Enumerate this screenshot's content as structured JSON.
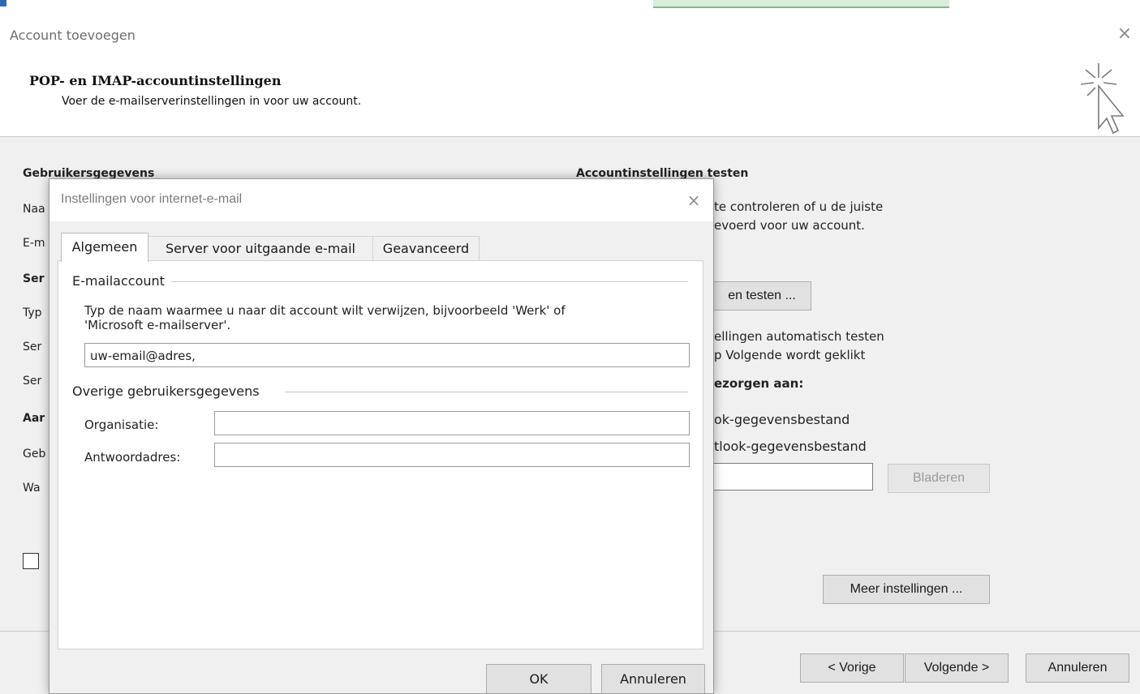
{
  "outer": {
    "title": "Account toevoegen",
    "close_icon": "×",
    "section_title": "POP- en IMAP-accountinstellingen",
    "section_subtitle": "Voer de e-mailserverinstellingen in voor uw account.",
    "left_labels": {
      "gebruikersgegevens": "Gebruikersgegevens",
      "naam": "Naa",
      "email": "E-m",
      "server": "Ser",
      "type": "Typ",
      "server2": "Ser",
      "server3": "Ser",
      "aanmelden": "Aar",
      "gebruiker": "Geb",
      "wachtwoord": "Wa"
    },
    "right": {
      "heading": "Accountinstellingen testen",
      "desc_line1": "te controleren of u de juiste",
      "desc_line2": "evoerd voor uw account.",
      "test_button": "en testen ...",
      "auto_line1": "ellingen automatisch testen",
      "auto_line2": "p Volgende wordt geklikt",
      "deliver_heading": "ezorgen aan:",
      "option1": "ok-gegevensbestand",
      "option2": "tlook-gegevensbestand",
      "browse_button": "Bladeren",
      "more_settings_button": "Meer instellingen ..."
    },
    "footer": {
      "prev_button": "< Vorige",
      "next_button": "Volgende >",
      "cancel_button": "Annuleren"
    }
  },
  "inner": {
    "title": "Instellingen voor internet-e-mail",
    "close_icon": "×",
    "tabs": [
      {
        "label": "Algemeen",
        "active": true
      },
      {
        "label": "Server voor uitgaande e-mail",
        "active": false
      },
      {
        "label": "Geavanceerd",
        "active": false
      }
    ],
    "email_account_group": "E-mailaccount",
    "email_account_desc_line1": "Typ de naam waarmee u naar dit account wilt verwijzen, bijvoorbeeld 'Werk' of",
    "email_account_desc_line2": "'Microsoft e-mailserver'.",
    "account_name_value": "uw-email@adres,",
    "other_group": "Overige gebruikersgegevens",
    "organisation_label": "Organisatie:",
    "organisation_value": "",
    "reply_label": "Antwoordadres:",
    "reply_value": "",
    "ok_button": "OK",
    "cancel_button": "Annuleren"
  }
}
